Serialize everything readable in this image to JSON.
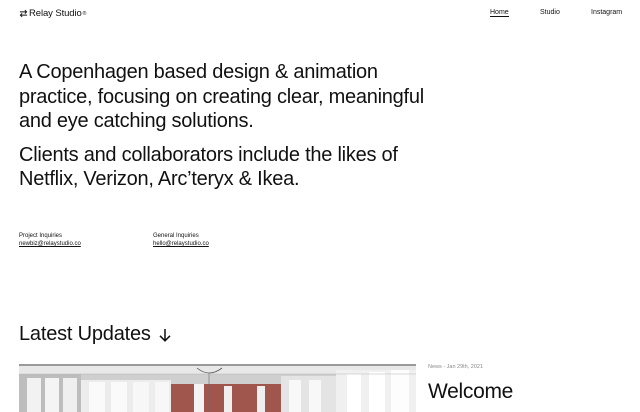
{
  "header": {
    "logo_text": "Relay Studio",
    "logo_mark": "®",
    "nav": [
      "Home",
      "Studio",
      "Instagram"
    ]
  },
  "hero": {
    "paragraph1": "A Copenhagen based design & animation practice, focusing on creating clear, meaningful and eye catching solutions.",
    "paragraph2": "Clients and collaborators include the likes of Netflix, Verizon, Arc’teryx & Ikea."
  },
  "contacts": [
    {
      "label": "Project Inquiries",
      "email": "newbiz@relaystudio.co"
    },
    {
      "label": "General Inquiries",
      "email": "hello@relaystudio.co"
    }
  ],
  "updates": {
    "heading": "Latest Updates",
    "post": {
      "meta": "News - Jan 29th, 2021",
      "title": "Welcome"
    }
  },
  "colors": {
    "text": "#111111",
    "muted": "#8a8a8a",
    "background": "#ffffff",
    "wall_accent": "#a0564c"
  }
}
